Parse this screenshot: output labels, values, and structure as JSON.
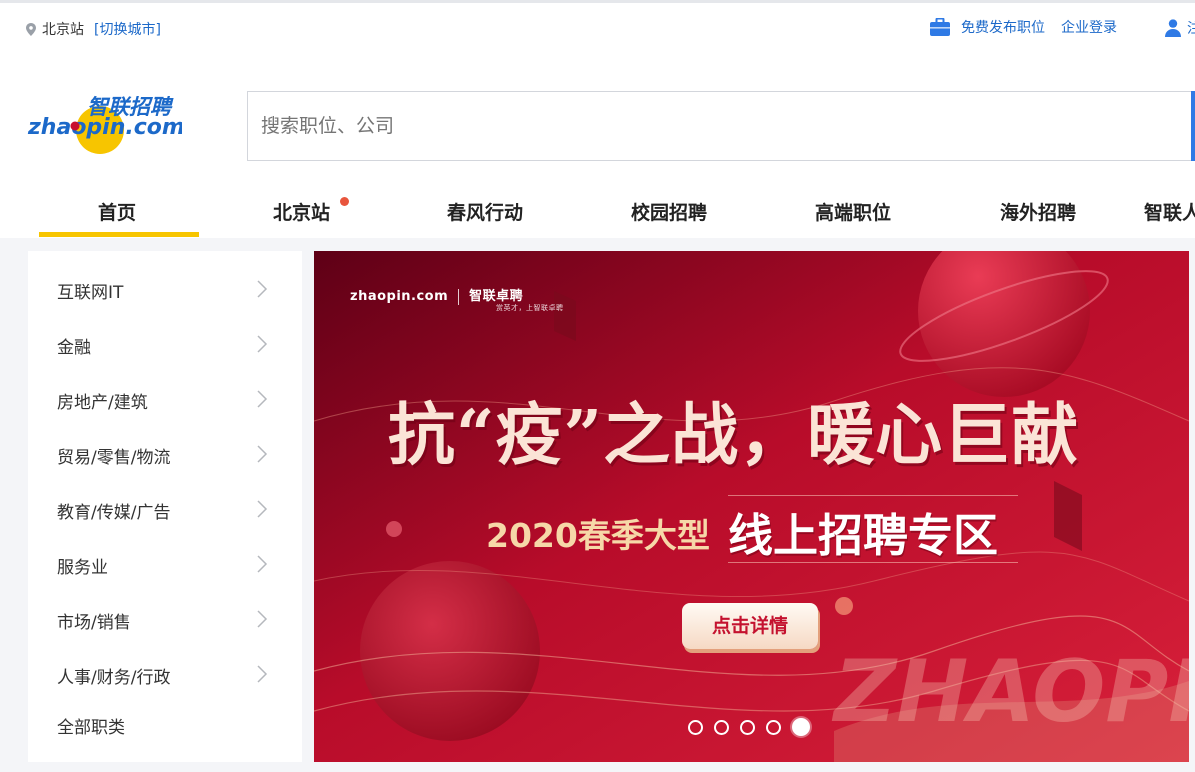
{
  "topbar": {
    "location": "北京站",
    "switch_city": "[切换城市]",
    "publish_job": "免费发布职位",
    "corp_login": "企业登录",
    "user_text_cut": "注"
  },
  "header": {
    "logo_cn": "智联招聘",
    "logo_en": "zhaopin.com",
    "search_placeholder": "搜索职位、公司"
  },
  "nav": {
    "items": [
      "首页",
      "北京站",
      "春风行动",
      "校园招聘",
      "高端职位",
      "海外招聘",
      "智联人"
    ],
    "active_index": 0,
    "colors": {
      "underline": "#f7c500",
      "dot": "#e8553d"
    }
  },
  "sidebar": {
    "categories": [
      "互联网IT",
      "金融",
      "房地产/建筑",
      "贸易/零售/物流",
      "教育/传媒/广告",
      "服务业",
      "市场/销售",
      "人事/财务/行政"
    ],
    "all_label": "全部职类"
  },
  "banner": {
    "logo_left": "zhaopin.com",
    "logo_right": "智联卓聘",
    "logo_right_sub": "赏英才，上智联卓聘",
    "headline": "抗“疫”之战，暖心巨献",
    "sub_left": "2020春季大型",
    "sub_right": "线上招聘专区",
    "button": "点击详情",
    "watermark": "ZHAOPIN",
    "slides": 5,
    "active_slide": 5,
    "colors": {
      "bg_dark": "#7a0019",
      "bg_mid": "#c8102e",
      "bg_light": "#e0283f"
    }
  },
  "colors": {
    "link_blue": "#1c69c9",
    "search_edge": "#2f7ae5",
    "page_bg": "#f4f5f8"
  }
}
